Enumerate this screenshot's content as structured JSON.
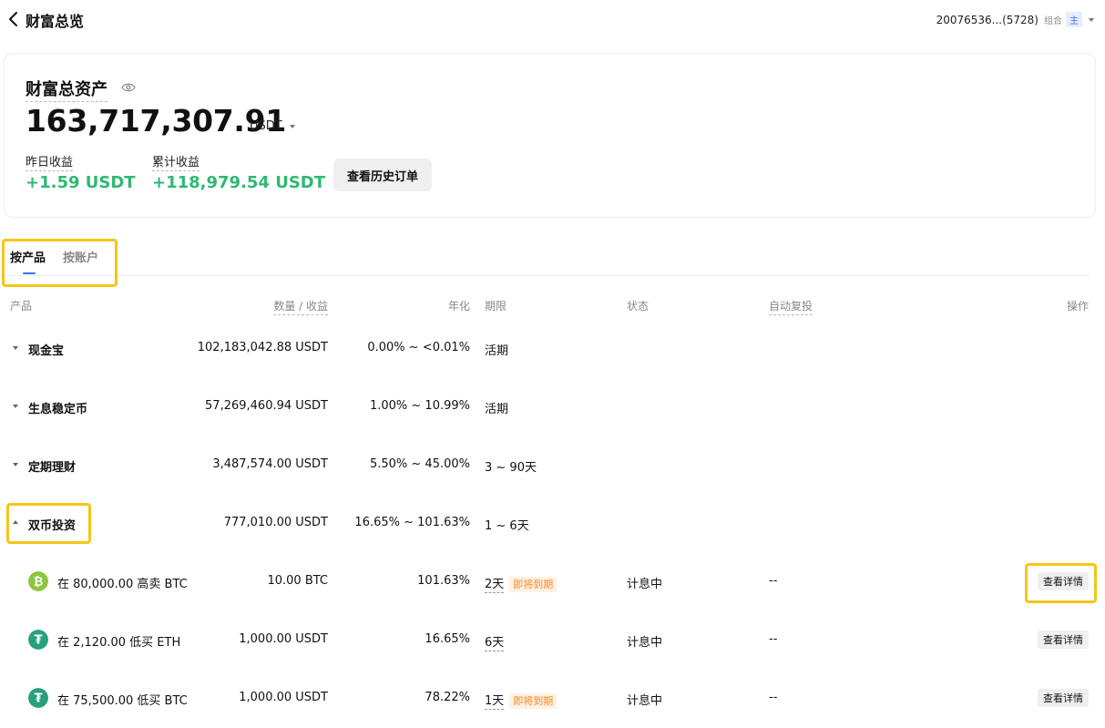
{
  "header": {
    "title": "财富总览",
    "account_id": "20076536...(5728)",
    "account_tag": "组合",
    "account_badge": "主"
  },
  "asset": {
    "label": "财富总资产",
    "total": "163,717,307.91",
    "unit": "USDT",
    "yesterday_label": "昨日收益",
    "yesterday_value": "+1.59 USDT",
    "cumulative_label": "累计收益",
    "cumulative_value": "+118,979.54 USDT",
    "history_button": "查看历史订单"
  },
  "tabs": [
    {
      "label": "按产品",
      "active": true
    },
    {
      "label": "按账户",
      "active": false
    }
  ],
  "table": {
    "headers": {
      "product": "产品",
      "amount": "数量 / 收益",
      "apr": "年化",
      "term": "期限",
      "status": "状态",
      "auto_reinvest": "自动复投",
      "action": "操作"
    },
    "groups": [
      {
        "name": "现金宝",
        "amount": "102,183,042.88 USDT",
        "apr": "0.00% ~ <0.01%",
        "term": "活期",
        "expanded": false
      },
      {
        "name": "生息稳定币",
        "amount": "57,269,460.94 USDT",
        "apr": "1.00% ~ 10.99%",
        "term": "活期",
        "expanded": false
      },
      {
        "name": "定期理财",
        "amount": "3,487,574.00 USDT",
        "apr": "5.50% ~ 45.00%",
        "term": "3 ~ 90天",
        "expanded": false
      },
      {
        "name": "双币投资",
        "amount": "777,010.00 USDT",
        "apr": "16.65% ~ 101.63%",
        "term": "1 ~ 6天",
        "expanded": true
      }
    ],
    "dual_items": [
      {
        "coin_icon": "bitcoin-icon",
        "coin_color": "#8cc63f",
        "name": "在 80,000.00 高卖 BTC",
        "amount": "10.00 BTC",
        "apr": "101.63%",
        "term": "2天",
        "badge": "即将到期",
        "status": "计息中",
        "auto": "--",
        "action": "查看详情"
      },
      {
        "coin_icon": "tether-icon",
        "coin_color": "#26a17b",
        "name": "在 2,120.00 低买 ETH",
        "amount": "1,000.00 USDT",
        "apr": "16.65%",
        "term": "6天",
        "badge": "",
        "status": "计息中",
        "auto": "--",
        "action": "查看详情"
      },
      {
        "coin_icon": "tether-icon",
        "coin_color": "#26a17b",
        "name": "在 75,500.00 低买 BTC",
        "amount": "1,000.00 USDT",
        "apr": "78.22%",
        "term": "1天",
        "badge": "即将到期",
        "status": "计息中",
        "auto": "--",
        "action": "查看详情"
      }
    ]
  },
  "colors": {
    "positive": "#2fb873",
    "accent": "#3b6fe0",
    "highlight": "#f5c518",
    "warning": "#f28b25"
  }
}
